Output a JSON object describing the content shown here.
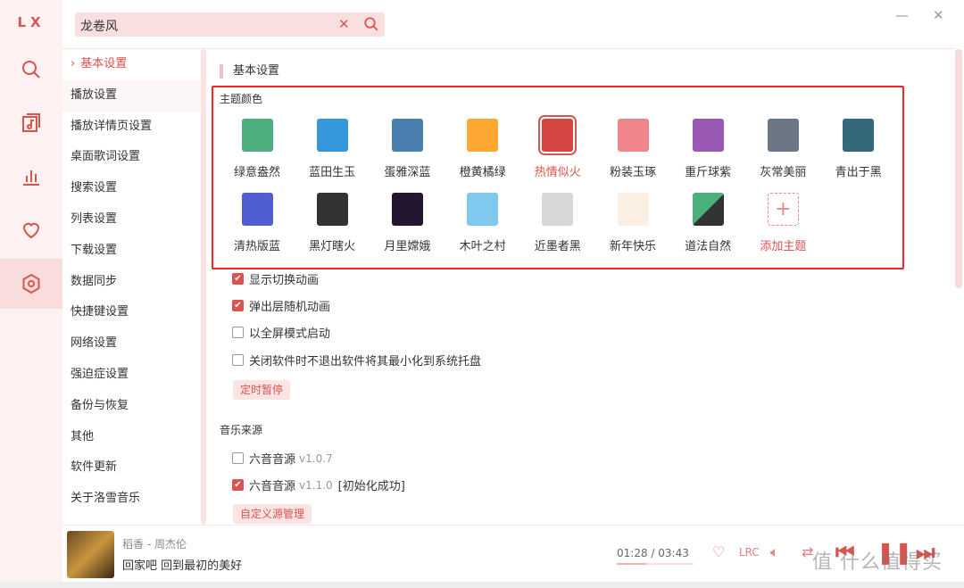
{
  "app": {
    "logo": "LX"
  },
  "rail": {
    "items": [
      {
        "icon": "search-icon"
      },
      {
        "icon": "music-list-icon"
      },
      {
        "icon": "chart-icon"
      },
      {
        "icon": "heart-icon"
      },
      {
        "icon": "settings-icon",
        "active": true
      }
    ]
  },
  "search": {
    "value": "龙卷风",
    "clear": "✕",
    "minimize": "—",
    "close": "✕"
  },
  "nav": {
    "items": [
      "基本设置",
      "播放设置",
      "播放详情页设置",
      "桌面歌词设置",
      "搜索设置",
      "列表设置",
      "下载设置",
      "数据同步",
      "快捷键设置",
      "网络设置",
      "强迫症设置",
      "备份与恢复",
      "其他",
      "软件更新",
      "关于洛雪音乐"
    ],
    "active": "基本设置",
    "active_marker": "›"
  },
  "main": {
    "section_title": "基本设置",
    "theme_label": "主题颜色",
    "themes": [
      {
        "name": "绿意盎然",
        "color": "#4caf7d"
      },
      {
        "name": "蓝田生玉",
        "color": "#3498db"
      },
      {
        "name": "蛋雅深蓝",
        "color": "#4a7fb0"
      },
      {
        "name": "橙黄橘绿",
        "color": "#ffa733"
      },
      {
        "name": "热情似火",
        "color": "#d64541",
        "selected": true
      },
      {
        "name": "粉装玉琢",
        "color": "#f0858c"
      },
      {
        "name": "重斤球紫",
        "color": "#9b59b6"
      },
      {
        "name": "灰常美丽",
        "color": "#6b7785"
      },
      {
        "name": "青出于黑",
        "color": "#35687a"
      },
      {
        "name": "清热版蓝",
        "color": "#4f5fd1"
      },
      {
        "name": "黑灯瞎火",
        "color": "#333333"
      },
      {
        "name": "月里嫦娥",
        "color": "#241530"
      },
      {
        "name": "木叶之村",
        "color": "#7fc9ee"
      },
      {
        "name": "近墨者黑",
        "color": "#d8d8d8"
      },
      {
        "name": "新年快乐",
        "color": "#fbeee2"
      },
      {
        "name": "道法自然",
        "color": "#4caf7d"
      }
    ],
    "add_theme": "添加主题",
    "options": [
      {
        "label": "显示切换动画",
        "checked": true
      },
      {
        "label": "弹出层随机动画",
        "checked": true
      },
      {
        "label": "以全屏模式启动",
        "checked": false
      },
      {
        "label": "关闭软件时不退出软件将其最小化到系统托盘",
        "checked": false
      }
    ],
    "timer_button": "定时暂停",
    "source_title": "音乐来源",
    "sources": [
      {
        "label": "六音音源",
        "version": "v1.0.7",
        "status": "",
        "checked": false
      },
      {
        "label": "六音音源",
        "version": "v1.1.0",
        "status": "[初始化成功]",
        "checked": true
      }
    ],
    "custom_source_button": "自定义源管理"
  },
  "player": {
    "title": "稻香 - 周杰伦",
    "lyric": "回家吧 回到最初的美好",
    "time": "01:28 / 03:43",
    "progress": 0.4,
    "lrc": "LRC"
  },
  "watermark": "值 什么值得买",
  "colors": {
    "accent": "#d9534f",
    "annotation": "#ff2222"
  }
}
